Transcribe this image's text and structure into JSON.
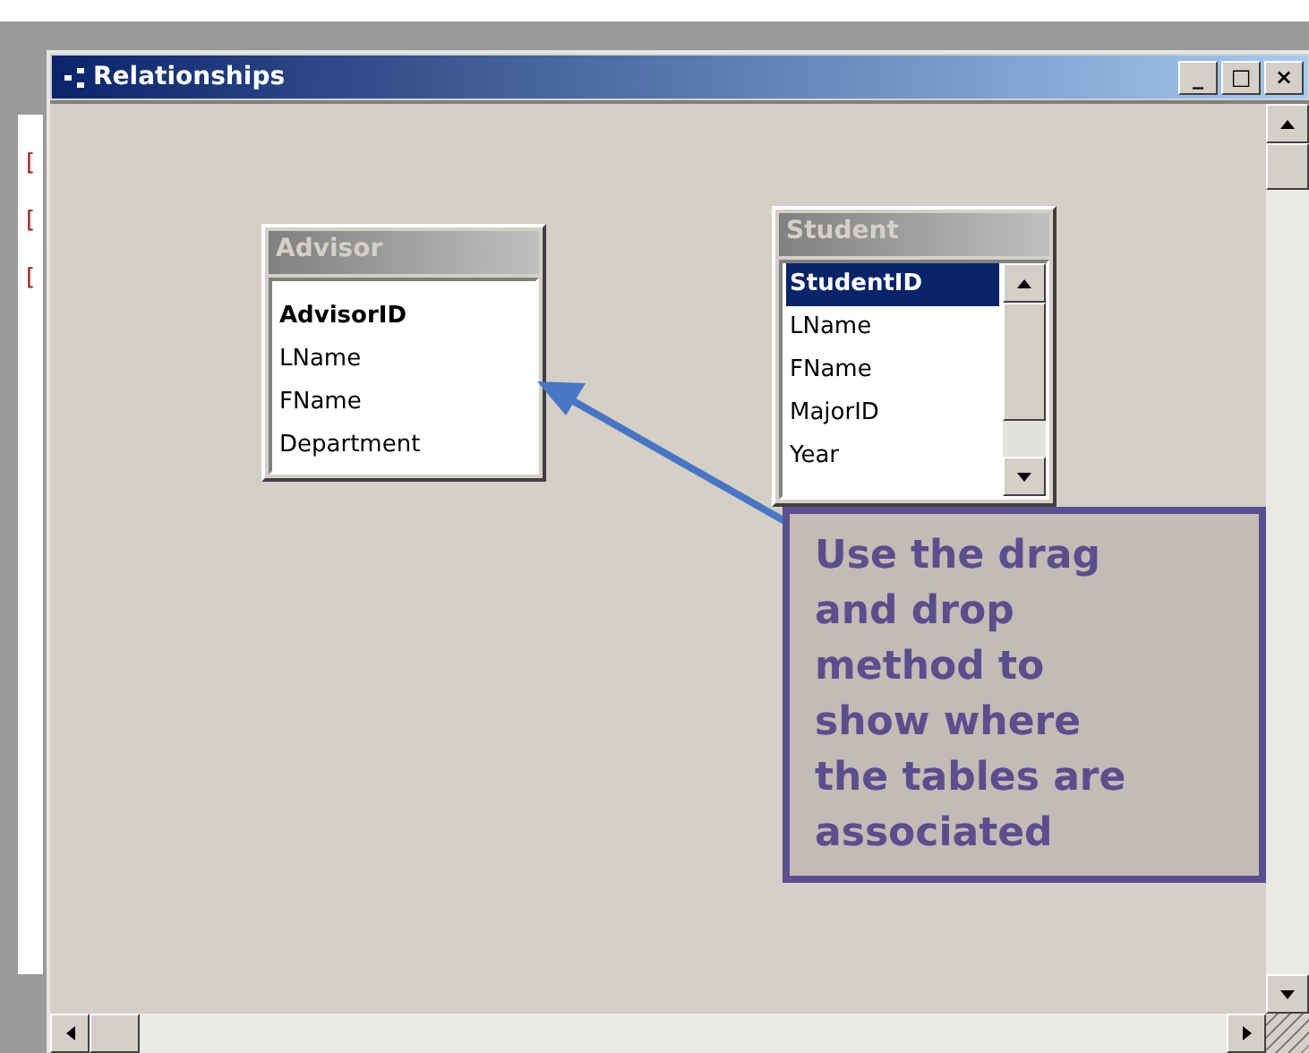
{
  "background": {
    "marks": [
      "[",
      "[",
      "["
    ]
  },
  "window": {
    "title": "Relationships",
    "controls": [
      "_",
      "□",
      "×"
    ]
  },
  "tables": [
    {
      "title": "Advisor",
      "scrollable": false,
      "fields": [
        {
          "name": "AdvisorID",
          "primary_key": true,
          "selected": false
        },
        {
          "name": "LName",
          "primary_key": false,
          "selected": false
        },
        {
          "name": "FName",
          "primary_key": false,
          "selected": false
        },
        {
          "name": "Department",
          "primary_key": false,
          "selected": false
        }
      ]
    },
    {
      "title": "Student",
      "scrollable": true,
      "fields": [
        {
          "name": "StudentID",
          "primary_key": true,
          "selected": true
        },
        {
          "name": "LName",
          "primary_key": false,
          "selected": false
        },
        {
          "name": "FName",
          "primary_key": false,
          "selected": false
        },
        {
          "name": "MajorID",
          "primary_key": false,
          "selected": false
        },
        {
          "name": "Year",
          "primary_key": false,
          "selected": false
        }
      ]
    }
  ],
  "callout": {
    "text": "Use the drag and drop method to show where the tables are associated"
  }
}
